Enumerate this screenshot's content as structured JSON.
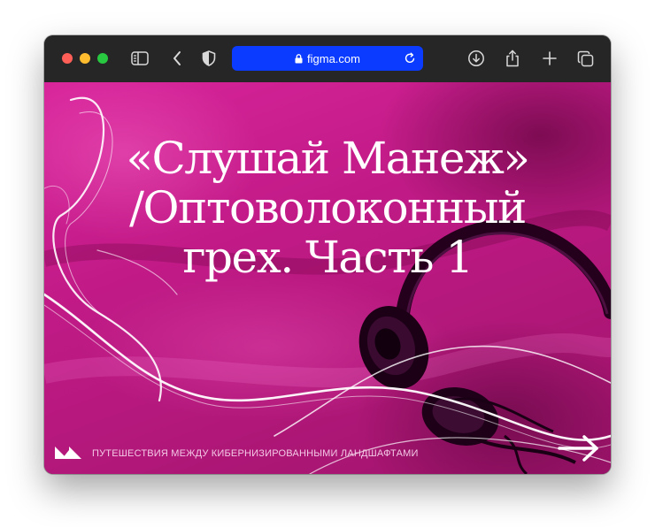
{
  "browser": {
    "url": "figma.com",
    "buttons": [
      "sidebar-toggle",
      "back",
      "privacy-shield",
      "downloads",
      "share",
      "new-tab",
      "tab-overview"
    ]
  },
  "hero": {
    "title_lines": [
      "«Слушай Манеж»",
      "/Оптоволоконный",
      "грех. Часть 1"
    ]
  },
  "footer": {
    "tagline": "ПУТЕШЕСТВИЯ МЕЖДУ КИБЕРНИЗИРОВАННЫМИ ЛАНДШАФТАМИ"
  },
  "colors": {
    "url_bar": "#0a3bff",
    "background_magenta": "#c01a86",
    "toolbar": "#262626"
  },
  "icons": [
    "lock-icon",
    "reload-icon",
    "download-icon",
    "share-icon",
    "plus-icon",
    "tabs-icon",
    "logo-mark",
    "arrow-right-icon"
  ]
}
